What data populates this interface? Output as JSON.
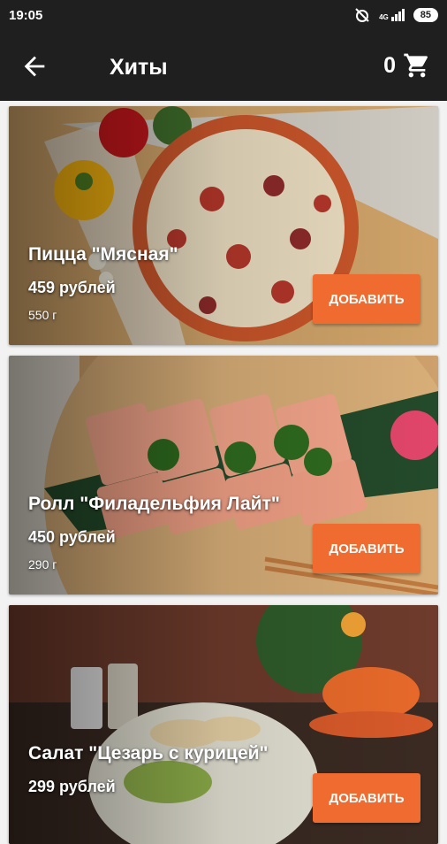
{
  "status": {
    "time": "19:05",
    "network": "4G",
    "battery": "85"
  },
  "header": {
    "title": "Хиты",
    "cart_count": "0"
  },
  "products": [
    {
      "name": "Пицца \"Мясная\"",
      "price": "459 рублей",
      "weight": "550 г",
      "button": "ДОБАВИТЬ"
    },
    {
      "name": "Ролл \"Филадельфия Лайт\"",
      "price": "450 рублей",
      "weight": "290 г",
      "button": "ДОБАВИТЬ"
    },
    {
      "name": "Салат \"Цезарь с курицей\"",
      "price": "299 рублей",
      "weight": "",
      "button": "ДОБАВИТЬ"
    }
  ],
  "icons": {
    "back": "arrow-back-icon",
    "cart": "shopping-cart-icon"
  },
  "colors": {
    "accent": "#ef6b2f",
    "appbar": "#1f1f1f"
  }
}
